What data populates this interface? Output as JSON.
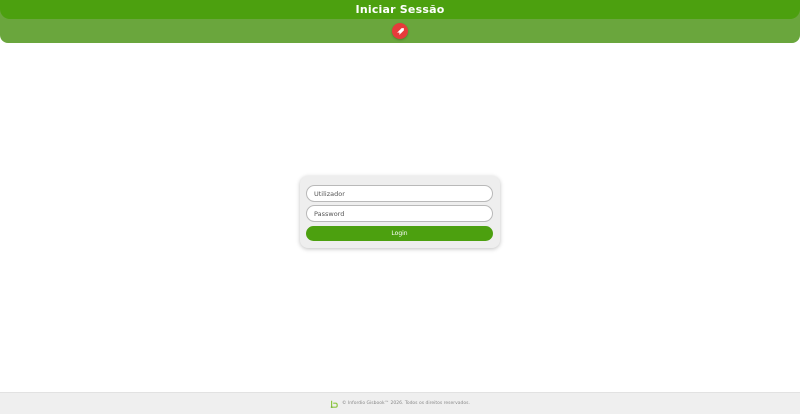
{
  "header": {
    "title": "Iniciar Sessão",
    "action_icon": "rocket-icon",
    "accent_color": "#4ca00f",
    "secondary_color": "#6aa63d",
    "action_color": "#e63b3b"
  },
  "login": {
    "username_placeholder": "Utilizador",
    "username_value": "",
    "password_placeholder": "Password",
    "password_value": "",
    "submit_label": "Login"
  },
  "footer": {
    "logo_icon": "infordio-logo-icon",
    "copyright": "© Infordio Gisbook™ 2026. Todos os direitos reservados."
  }
}
